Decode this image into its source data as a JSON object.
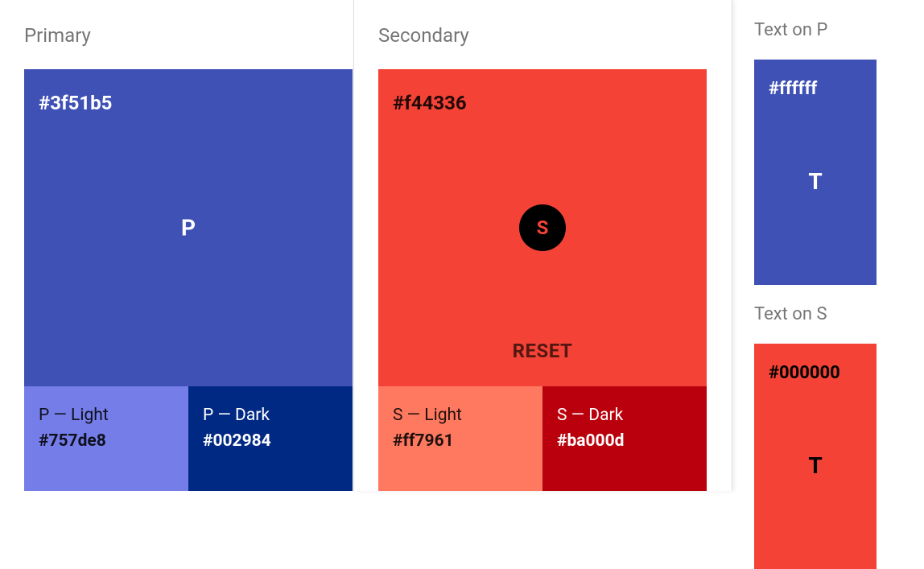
{
  "primary": {
    "title": "Primary",
    "hex": "#3f51b5",
    "color": "#3f51b5",
    "textColor": "#ffffff",
    "center": "P",
    "light": {
      "label": "P — Light",
      "hex": "#757de8",
      "color": "#757de8",
      "textColor": "rgba(0,0,0,0.87)"
    },
    "dark": {
      "label": "P — Dark",
      "hex": "#002984",
      "color": "#002984",
      "textColor": "#ffffff"
    }
  },
  "secondary": {
    "title": "Secondary",
    "hex": "#f44336",
    "color": "#f44336",
    "textColor": "rgba(0,0,0,0.87)",
    "fab": "S",
    "reset": "RESET",
    "light": {
      "label": "S — Light",
      "hex": "#ff7961",
      "color": "#ff7961",
      "textColor": "rgba(0,0,0,0.87)"
    },
    "dark": {
      "label": "S — Dark",
      "hex": "#ba000d",
      "color": "#ba000d",
      "textColor": "#ffffff"
    }
  },
  "textOnP": {
    "title": "Text on P",
    "hex": "#ffffff",
    "bg": "#3f51b5",
    "textColor": "#ffffff",
    "center": "T"
  },
  "textOnS": {
    "title": "Text on S",
    "hex": "#000000",
    "bg": "#f44336",
    "textColor": "#000000",
    "center": "T"
  }
}
